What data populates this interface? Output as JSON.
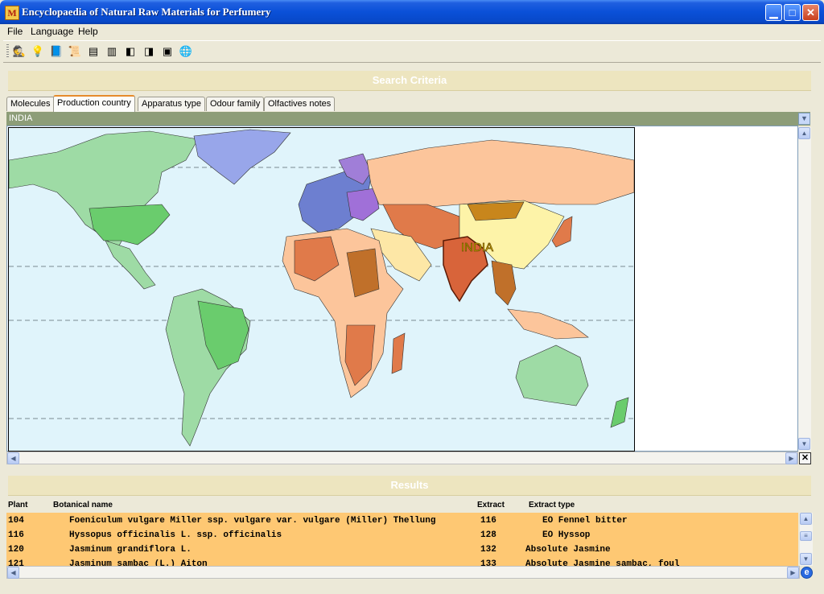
{
  "window": {
    "title": "Encyclopaedia of Natural Raw Materials for Perfumery",
    "icon": "M"
  },
  "menu": [
    "File",
    "Language",
    "Help"
  ],
  "toolbar": [
    {
      "name": "detective-icon",
      "glyph": "🕵"
    },
    {
      "name": "pin-icon",
      "glyph": "💡"
    },
    {
      "name": "book-icon",
      "glyph": "📘"
    },
    {
      "name": "paper-icon",
      "glyph": "📜"
    },
    {
      "name": "panel-left-icon",
      "glyph": "▤"
    },
    {
      "name": "panel-split-icon",
      "glyph": "▥"
    },
    {
      "name": "panel-arrow-left-icon",
      "glyph": "◧"
    },
    {
      "name": "panel-arrow-right-icon",
      "glyph": "◨"
    },
    {
      "name": "window-icon",
      "glyph": "▣"
    },
    {
      "name": "globe-icon",
      "glyph": "🌐"
    }
  ],
  "search": {
    "header": "Search Criteria",
    "tabs": [
      "Molecules",
      "Production country",
      "Apparatus type",
      "Odour family",
      "Olfactives notes"
    ],
    "active_tab": "Production country",
    "selected_country": "INDIA",
    "map_label": "INDIA"
  },
  "results": {
    "header": "Results",
    "columns": {
      "plant": "Plant",
      "botanical": "Botanical name",
      "extract": "Extract",
      "extract_type": "Extract type"
    },
    "rows": [
      {
        "plant": "104",
        "botanical": "Foeniculum vulgare Miller ssp. vulgare var. vulgare (Miller) Thellung",
        "extract": "116",
        "extract_type": "EO Fennel bitter"
      },
      {
        "plant": "116",
        "botanical": "Hyssopus officinalis L. ssp. officinalis",
        "extract": "128",
        "extract_type": "EO Hyssop"
      },
      {
        "plant": "120",
        "botanical": "Jasminum grandiflora L.",
        "extract": "132",
        "extract_type": "Absolute Jasmine"
      },
      {
        "plant": "121",
        "botanical": "Jasminum sambac (L.) Aiton",
        "extract": "133",
        "extract_type": "Absolute Jasmine sambac, foul"
      }
    ]
  },
  "colors": {
    "titlebar": "#0a50d8",
    "section_header": "#ede5bf",
    "country_bar": "#8d9d78",
    "map_sea": "#e0f4fb",
    "results_row": "#fec873",
    "active_tab_accent": "#e68b2c"
  }
}
